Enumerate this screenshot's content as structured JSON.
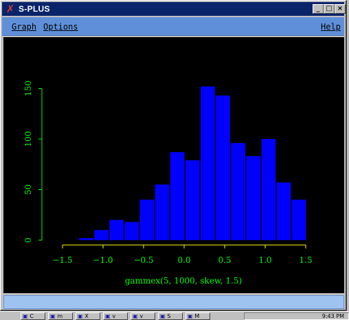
{
  "window": {
    "title": "S-PLUS",
    "title_icon": "splus-x-icon",
    "buttons": [
      "minimize",
      "maximize",
      "close"
    ]
  },
  "menu": {
    "graph": "Graph",
    "options": "Options",
    "help": "Help"
  },
  "colors": {
    "bars": "#0000ff",
    "axis_labels": "#00ff00",
    "x_axis_line": "#ffff00",
    "plot_background": "#000000",
    "title_bar": "#0a246a",
    "menu_bar": "#5f8fd8"
  },
  "chart_data": {
    "type": "bar",
    "title": "",
    "xlabel": "gammex(5, 1000, skew, 1.5)",
    "ylabel": "",
    "bin_width": 0.1875,
    "bin_edges_start": -1.3,
    "values": [
      2,
      10,
      20,
      18,
      40,
      55,
      87,
      79,
      152,
      143,
      96,
      83,
      100,
      57,
      40
    ],
    "xlim": [
      -1.5,
      1.6
    ],
    "ylim": [
      0,
      152
    ],
    "xticks": [
      -1.5,
      -1.0,
      -0.5,
      0.0,
      0.5,
      1.0,
      1.5
    ],
    "xtick_labels": [
      "-1.5",
      "-1.0",
      "-0.5",
      "0.0",
      "0.5",
      "1.0",
      "1.5"
    ],
    "yticks": [
      0,
      50,
      100,
      150
    ],
    "ytick_labels": [
      "0",
      "50",
      "100",
      "150"
    ]
  },
  "taskbar": {
    "items": [
      {
        "icon": "app-icon",
        "label": "C"
      },
      {
        "icon": "monitor-icon",
        "label": "m"
      },
      {
        "icon": "v-icon",
        "label": "X"
      },
      {
        "icon": "v-icon",
        "label": "v"
      },
      {
        "icon": "v-icon",
        "label": "v"
      },
      {
        "icon": "splus-icon",
        "label": "S"
      },
      {
        "icon": "app-icon",
        "label": "M"
      }
    ],
    "clock": "9:43 PM"
  }
}
